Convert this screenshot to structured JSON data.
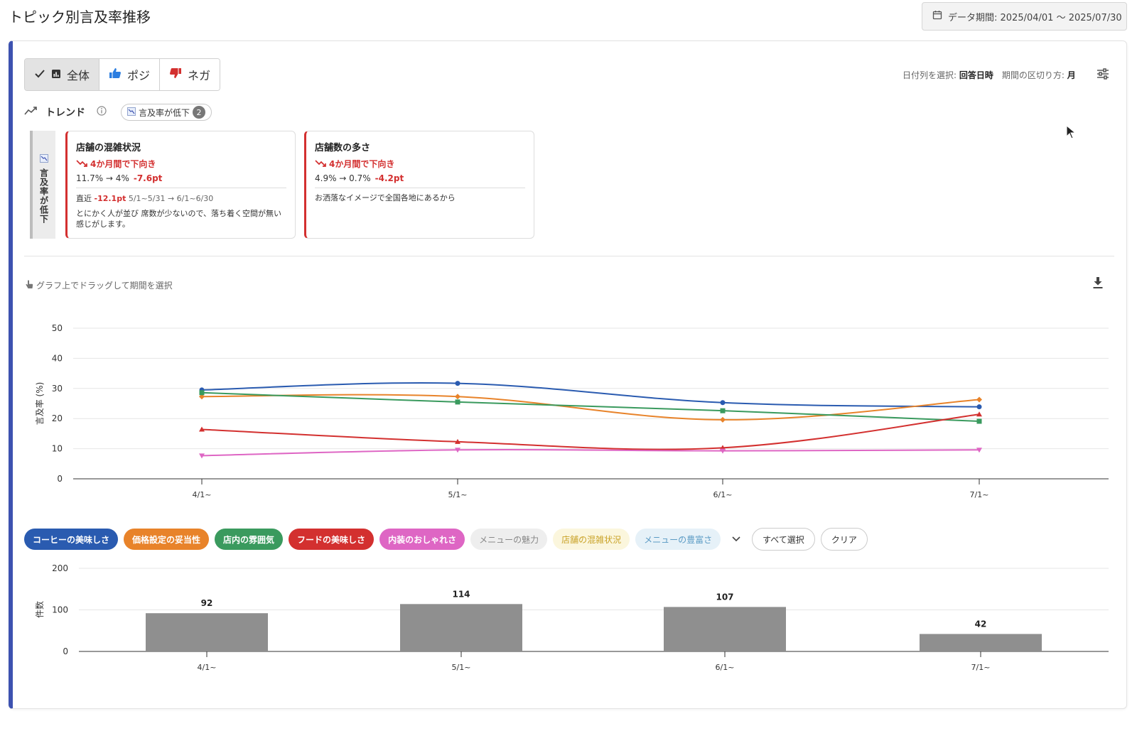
{
  "header": {
    "title": "トピック別言及率推移",
    "period_label": "データ期間: 2025/04/01 〜 2025/07/30"
  },
  "segments": [
    {
      "label": "全体",
      "active": true,
      "icon": "bar-chart-icon"
    },
    {
      "label": "ポジ",
      "active": false,
      "icon": "thumbs-up-icon"
    },
    {
      "label": "ネガ",
      "active": false,
      "icon": "thumbs-down-icon"
    }
  ],
  "controls": {
    "date_column_label": "日付列を選択:",
    "date_column_value": "回答日時",
    "interval_label": "期間の区切り方:",
    "interval_value": "月"
  },
  "trend": {
    "label": "トレンド",
    "filter_chip": "言及率が低下",
    "filter_count": "2",
    "vertical_tab": "言及率が低下",
    "cards": [
      {
        "title": "店舗の混雑状況",
        "trend": "4か月間で下向き",
        "values": "11.7% → 4%",
        "delta": "-7.6pt",
        "recent_label": "直近",
        "recent_delta": "-12.1pt",
        "recent_range": "5/1~5/31 → 6/1~6/30",
        "quote": "とにかく人が並び 席数が少ないので、落ち着く空間が無い感じがします。"
      },
      {
        "title": "店舗数の多さ",
        "trend": "4か月間で下向き",
        "values": "4.9% → 0.7%",
        "delta": "-4.2pt",
        "quote": "お洒落なイメージで全国各地にあるから"
      }
    ]
  },
  "chart_hint": "グラフ上でドラッグして期間を選択",
  "chart_data": [
    {
      "type": "line",
      "ylabel": "言及率 (%)",
      "ylim": [
        0,
        50
      ],
      "yticks": [
        "0",
        "10",
        "20",
        "30",
        "40",
        "50"
      ],
      "categories": [
        "4/1~",
        "5/1~",
        "6/1~",
        "7/1~"
      ],
      "series": [
        {
          "name": "コーヒーの美味しさ",
          "color": "#2a5bb0",
          "marker": "circle",
          "values": [
            29.5,
            31.7,
            25.3,
            23.9
          ]
        },
        {
          "name": "価格設定の妥当性",
          "color": "#e8832a",
          "marker": "diamond",
          "values": [
            27.3,
            27.3,
            19.6,
            26.3
          ]
        },
        {
          "name": "店内の雰囲気",
          "color": "#3a9a5e",
          "marker": "square",
          "values": [
            28.6,
            25.5,
            22.6,
            19.1
          ]
        },
        {
          "name": "フードの美味しさ",
          "color": "#d3302f",
          "marker": "triangle",
          "values": [
            16.4,
            12.3,
            10.3,
            21.4
          ]
        },
        {
          "name": "内装のおしゃれさ",
          "color": "#de66c4",
          "marker": "triangle-down",
          "values": [
            7.7,
            9.6,
            9.3,
            9.6
          ]
        }
      ]
    },
    {
      "type": "bar",
      "ylabel": "件数",
      "ylim": [
        0,
        200
      ],
      "yticks": [
        "0",
        "100",
        "200"
      ],
      "categories": [
        "4/1~",
        "5/1~",
        "6/1~",
        "7/1~"
      ],
      "values": [
        92,
        114,
        107,
        42
      ],
      "color": "#8f8f8f"
    }
  ],
  "legend": {
    "items": [
      {
        "label": "コーヒーの美味しさ",
        "active": true,
        "color": "#2a5bb0"
      },
      {
        "label": "価格設定の妥当性",
        "active": true,
        "color": "#e8832a"
      },
      {
        "label": "店内の雰囲気",
        "active": true,
        "color": "#3a9a5e"
      },
      {
        "label": "フードの美味しさ",
        "active": true,
        "color": "#d3302f"
      },
      {
        "label": "内装のおしゃれさ",
        "active": true,
        "color": "#de66c4"
      },
      {
        "label": "メニューの魅力",
        "active": false,
        "color": "#888888"
      },
      {
        "label": "店舗の混雑状況",
        "active": false,
        "color": "#c9a227",
        "bg": "#fbf6dd"
      },
      {
        "label": "メニューの豊富さ",
        "active": false,
        "color": "#5a9ac4",
        "bg": "#e6f1f8"
      }
    ],
    "select_all": "すべて選択",
    "clear": "クリア"
  }
}
